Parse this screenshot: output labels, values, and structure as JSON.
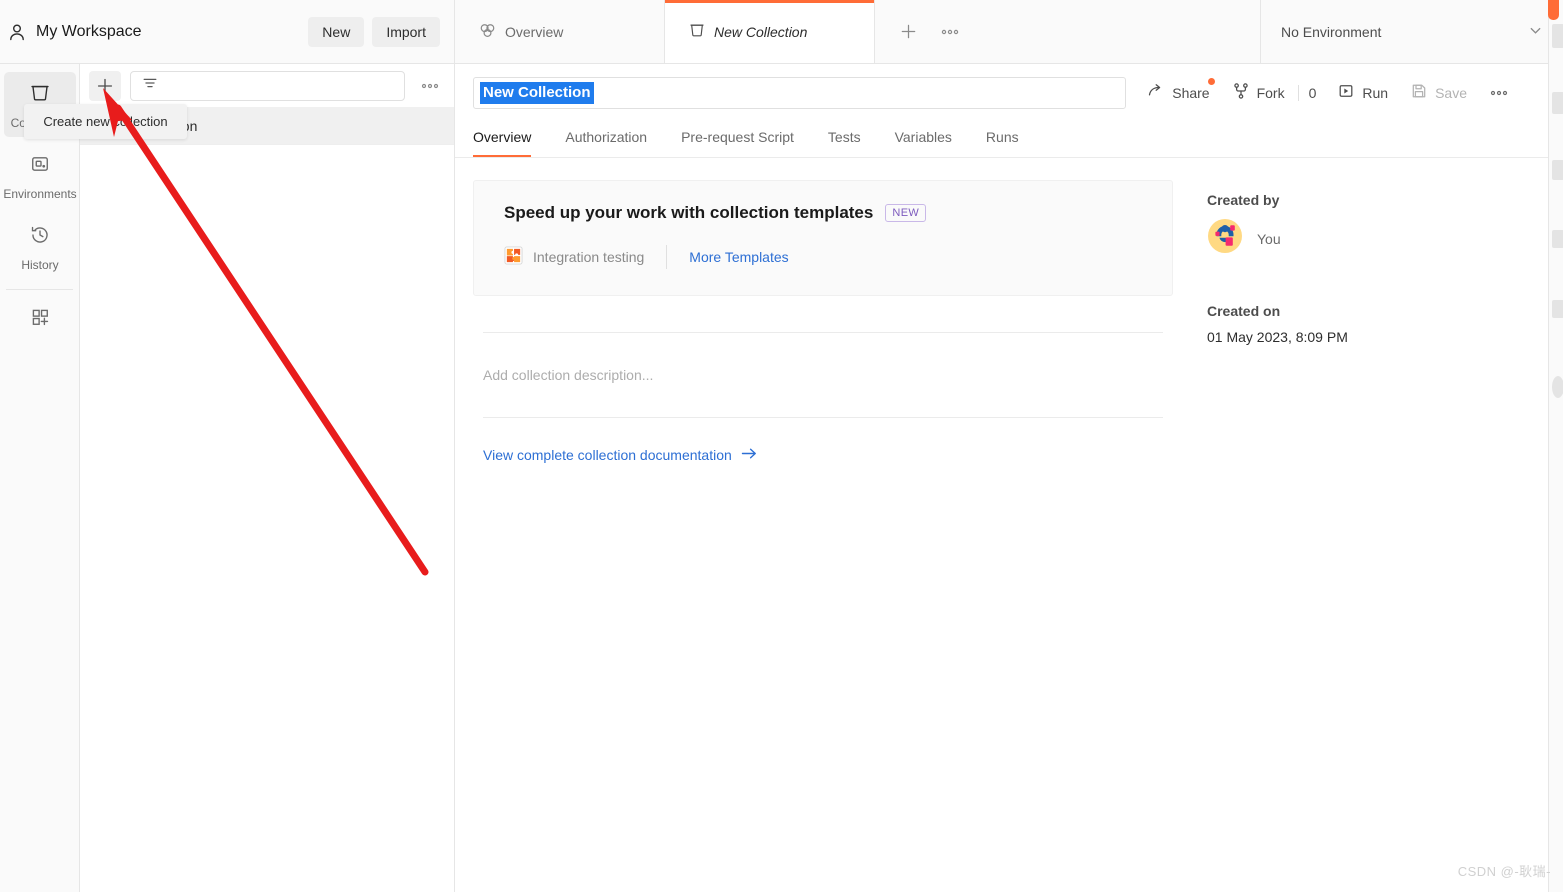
{
  "workspace": {
    "icon": "user-icon",
    "title": "My Workspace",
    "new_label": "New",
    "import_label": "Import"
  },
  "tabs": {
    "items": [
      {
        "label": "Overview",
        "icon": "overview-circles-icon",
        "active": false
      },
      {
        "label": "New Collection",
        "icon": "collection-icon",
        "active": true
      }
    ],
    "new_tab_icon": "plus-icon",
    "more_icon": "ellipsis-icon"
  },
  "environment": {
    "selected": "No Environment",
    "chevron_icon": "chevron-down-icon"
  },
  "rail": {
    "items": [
      {
        "label": "Collections",
        "icon": "collection-icon",
        "selected": true
      },
      {
        "label": "Environments",
        "icon": "environment-icon",
        "selected": false
      },
      {
        "label": "History",
        "icon": "history-clock-icon",
        "selected": false
      },
      {
        "label": "",
        "icon": "new-apps-icon",
        "selected": false
      }
    ]
  },
  "sidebar": {
    "create_icon": "plus-icon",
    "filter_icon": "filter-sort-icon",
    "filter_placeholder": "",
    "more_icon": "ellipsis-icon",
    "rows": [
      {
        "label": "New Collection",
        "visible_text": "lection"
      }
    ]
  },
  "tooltip": {
    "text": "Create new collection"
  },
  "collection": {
    "name": "New Collection",
    "tabs": [
      {
        "label": "Overview",
        "active": true
      },
      {
        "label": "Authorization",
        "active": false
      },
      {
        "label": "Pre-request Script",
        "active": false
      },
      {
        "label": "Tests",
        "active": false
      },
      {
        "label": "Variables",
        "active": false
      },
      {
        "label": "Runs",
        "active": false
      }
    ],
    "actions": {
      "share_label": "Share",
      "share_icon": "share-arrow-icon",
      "share_has_badge": true,
      "fork_label": "Fork",
      "fork_icon": "fork-branch-icon",
      "fork_count": "0",
      "run_label": "Run",
      "run_icon": "play-icon",
      "save_label": "Save",
      "save_icon": "floppy-disk-icon",
      "more_icon": "ellipsis-icon"
    },
    "templates": {
      "title": "Speed up your work with collection templates",
      "badge": "NEW",
      "item_label": "Integration testing",
      "item_icon": "puzzle-piece-icon",
      "more_label": "More Templates"
    },
    "description_placeholder": "Add collection description...",
    "doc_link_label": "View complete collection documentation",
    "doc_link_icon": "arrow-right-icon",
    "meta": {
      "created_by_label": "Created by",
      "created_by_value": "You",
      "avatar_icon": "user-avatar",
      "created_on_label": "Created on",
      "created_on_value": "01 May 2023, 8:09 PM"
    }
  },
  "watermark": {
    "text": "CSDN @-耿瑞-"
  },
  "colors": {
    "accent": "#ff6c37",
    "link": "#2d6fd4",
    "selection": "#1f7ced",
    "badge_purple": "#7d5bbe",
    "annotation_red": "#e81c1c"
  }
}
